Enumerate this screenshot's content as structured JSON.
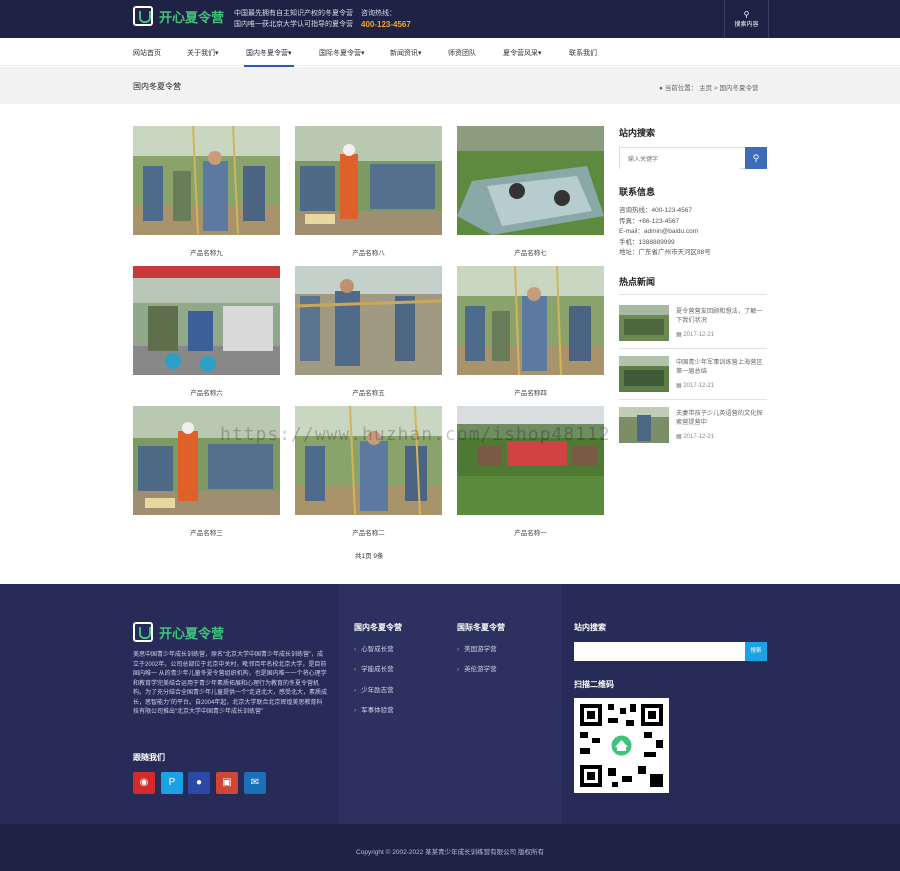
{
  "header": {
    "logo_text": "开心夏令营",
    "slogan_line1": "中国最先拥有自主知识产权的冬夏令营",
    "slogan_line2": "国内唯一获北京大学认可指导的夏令营",
    "hotline_label": "咨询热线：",
    "hotline_number": "400-123-4567",
    "search_label": "搜索内容"
  },
  "nav": {
    "items": [
      {
        "label": "网站首页"
      },
      {
        "label": "关于我们▾"
      },
      {
        "label": "国内冬夏令营▾"
      },
      {
        "label": "国际冬夏令营▾"
      },
      {
        "label": "新闻资讯▾"
      },
      {
        "label": "师资团队"
      },
      {
        "label": "夏令营风采▾"
      },
      {
        "label": "联系我们"
      }
    ]
  },
  "page": {
    "title": "国内冬夏令营",
    "crumb_label": "当前位置：",
    "crumb_home": "主页",
    "crumb_sep": ">",
    "crumb_current": "国内冬夏令营"
  },
  "products": [
    {
      "name": "产品名称九"
    },
    {
      "name": "产品名称八"
    },
    {
      "name": "产品名称七"
    },
    {
      "name": "产品名称六"
    },
    {
      "name": "产品名称五"
    },
    {
      "name": "产品名称四"
    },
    {
      "name": "产品名称三"
    },
    {
      "name": "产品名称二"
    },
    {
      "name": "产品名称一"
    }
  ],
  "pager": "共1页 9条",
  "sidebar": {
    "search_title": "站内搜索",
    "search_placeholder": "输入关键字",
    "contact_title": "联系信息",
    "contact": {
      "hotline": "咨询热线：400-123-4567",
      "fax": "传真：+86-123-4567",
      "email": "E-mail：admin@baidu.com",
      "phone": "手机：1388889999",
      "address": "地址：广东省广州市天河区88号"
    },
    "news_title": "热点新闻",
    "news": [
      {
        "title": "夏令营营友回顾和想法，了解一下我们状况",
        "date": "2017-12-21"
      },
      {
        "title": "中国青少年军事训练营上海营区第一届总结",
        "date": "2017-12-21"
      },
      {
        "title": "夫妻带孩子少儿英语营的文化探索营提营中",
        "date": "2017-12-21"
      }
    ]
  },
  "footer": {
    "logo_text": "开心夏令营",
    "about": "美思中国青少年成长训练营，原名“北京大学中国青少年成长训练营”，成立于2002年。公司总部位于北京中关村，毗邻百年名校北京大学，是目前国内唯一 从的青少年儿童冬夏令营组织机构，也是国内唯一一个将心理学和教育学完美结合运用于青少年素质拓展和心理行为教育的冬夏令营机构。为了充分结合全国青少年儿童提供一个“走进北大，感受北大，素质成长，思智能力”的平台。自2004年起，北京大学联合北京辉煌美思教育科技有限公司推出“北京大学中国青少年成长训练营”",
    "follow_title": "跟随我们",
    "col1_title": "国内冬夏令营",
    "col1_links": [
      "心智成长营",
      "学能成长营",
      "少年励志营",
      "军事体验营"
    ],
    "col2_title": "国际冬夏令营",
    "col2_links": [
      "美国游学营",
      "英伦游学营"
    ],
    "search_title": "站内搜索",
    "search_button": "搜索",
    "qr_title": "扫描二维码",
    "copyright": "Copyright © 2002-2022 某某青少年成长训练营有限公司 版权所有"
  },
  "watermark": "https://www.huzhan.com/ishop48112",
  "colors": {
    "header_bg": "#1e2244",
    "accent_green": "#3fc37a",
    "hotline": "#f5a623",
    "search_blue": "#3c6db8",
    "footer_bg": "#272b57"
  }
}
